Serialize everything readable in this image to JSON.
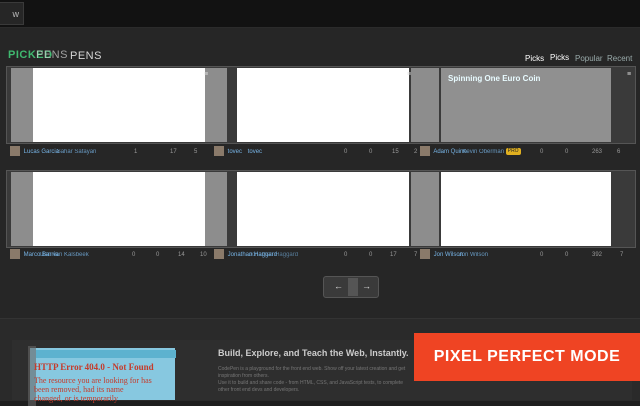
{
  "header": {
    "new_pen_label": "w Pen"
  },
  "section": {
    "title_green": "PICKED",
    "title_white_1": "PENS",
    "title_white_2": "PENS"
  },
  "nav": {
    "picks": "Picks",
    "picks_ghost": "Picks",
    "popular": "Popular",
    "recent": "Recent"
  },
  "row1": [
    {
      "author": "Lucas Garcia",
      "author_ghost": "Sahar Safayan",
      "stat_a": "1",
      "stat_b": "17",
      "stat_c": "5"
    },
    {
      "author": "tovec",
      "author_ghost": "tovec",
      "stat_a": "0",
      "stat_b": "0",
      "stat_c": "15",
      "stat_d": "2"
    },
    {
      "author": "Adam Quinn",
      "author_ghost": "Kevin Oberman",
      "badge": "PRO",
      "stat_a": "0",
      "stat_b": "0",
      "stat_c": "263",
      "stat_d": "6",
      "title": "Spinning One Euro Coin"
    }
  ],
  "row2": [
    {
      "author": "Marco Barría",
      "author_ghost": "Dan van Kalsbeek",
      "stat_a": "0",
      "stat_b": "0",
      "stat_c": "14",
      "stat_d": "10"
    },
    {
      "author": "Jonathan Haggard",
      "author_ghost": "Jonathan Haggard",
      "stat_a": "0",
      "stat_b": "0",
      "stat_c": "17",
      "stat_d": "7"
    },
    {
      "author": "Jon Wilson",
      "author_ghost": "Jon Wilson",
      "stat_a": "0",
      "stat_b": "0",
      "stat_c": "392",
      "stat_d": "7"
    }
  ],
  "pager": {
    "prev": "←",
    "next": "→"
  },
  "footer": {
    "heading": "Build, Explore, and Teach the Web, Instantly.",
    "body_1": "CodePen is a playground for the front end web. Show off your latest creation and get inspiration from others.",
    "body_2": "Use it to build and share code - from HTML, CSS, and JavaScript tests, to complete",
    "body_3": "other front end devs and developers.",
    "error_title": "HTTP Error 404.0 - Not Found",
    "error_line_1": "The resource you are looking for has",
    "error_line_2": "been removed, had its name",
    "error_line_3": "changed, or is temporarily"
  },
  "badge_mode": "PIXEL PERFECT MODE"
}
